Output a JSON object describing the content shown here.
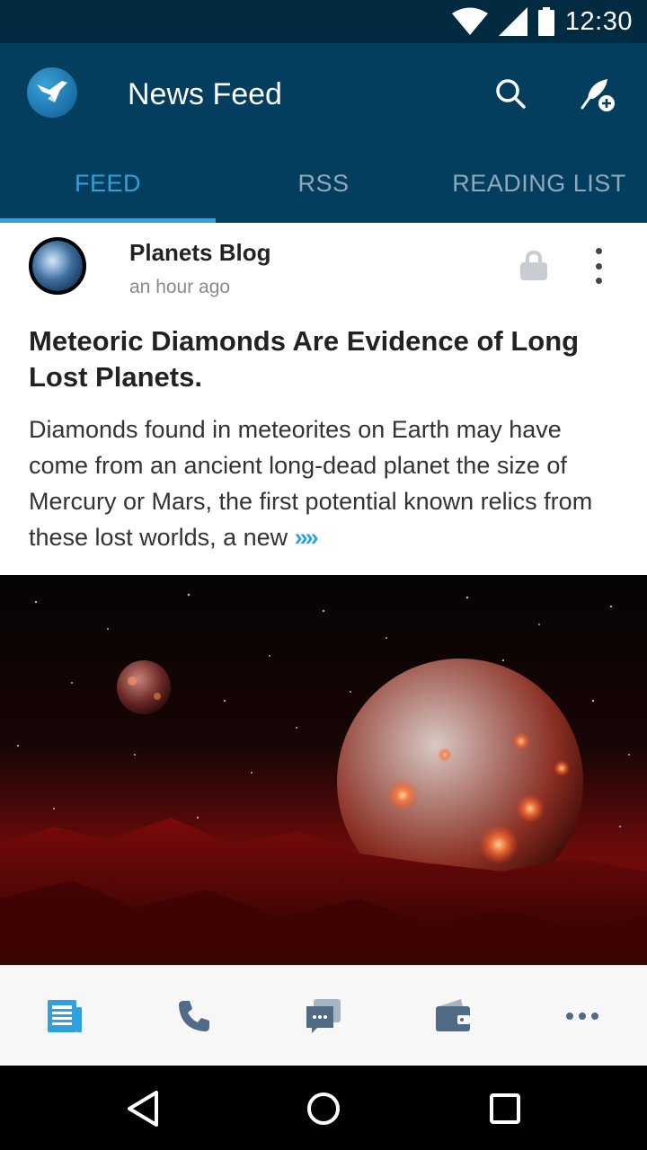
{
  "status_bar": {
    "time": "12:30",
    "icons": [
      "wifi-icon",
      "cell-signal-icon",
      "battery-icon"
    ]
  },
  "app_bar": {
    "title": "News Feed",
    "logo_icon": "bird-logo-icon",
    "actions": [
      "search-icon",
      "add-feather-icon"
    ]
  },
  "tabs": [
    {
      "label": "FEED",
      "active": true
    },
    {
      "label": "RSS",
      "active": false
    },
    {
      "label": "READING LIST",
      "active": false
    }
  ],
  "post": {
    "blog_name": "Planets Blog",
    "time": "an hour ago",
    "title": "Meteoric Diamonds Are Evidence of Long Lost Planets.",
    "excerpt": "Diamonds found in meteorites on Earth may have come from an ancient long-dead planet the size of Mercury or Mars, the first potential known relics from these lost worlds, a new",
    "read_more": "»»"
  },
  "bottom_nav": [
    "news-icon",
    "phone-icon",
    "chat-icon",
    "wallet-icon",
    "more-horiz-icon"
  ],
  "colors": {
    "status_bar": "#022a40",
    "app_bar": "#033e5e",
    "accent": "#2ea1de",
    "tab_inactive": "#8fa9bb"
  }
}
